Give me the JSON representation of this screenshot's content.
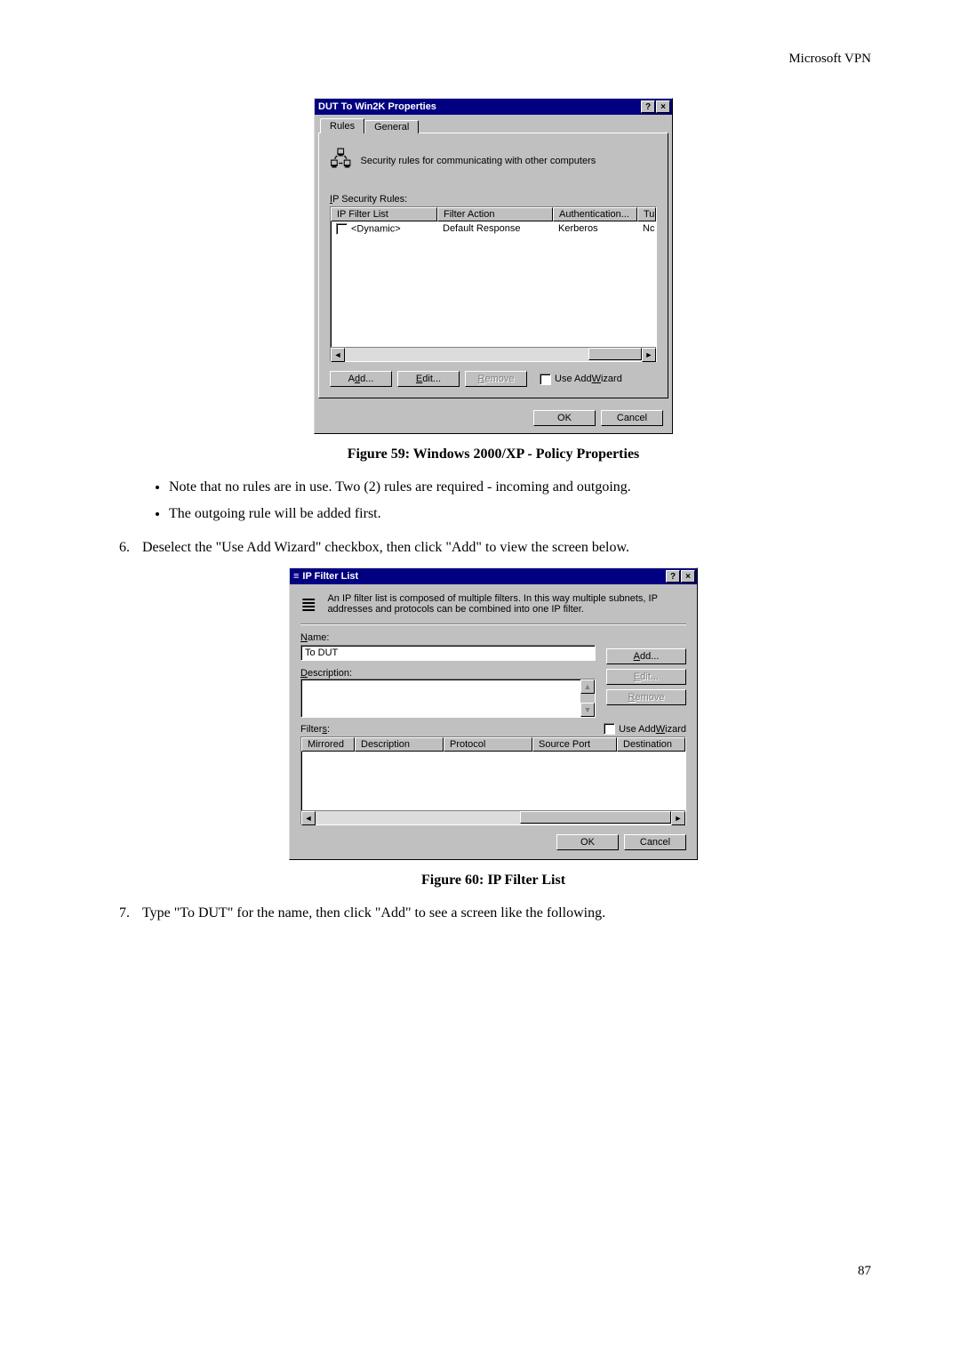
{
  "doc": {
    "header": "Microsoft VPN",
    "page_number": "87"
  },
  "dialog1": {
    "title": "DUT To Win2K Properties",
    "tabs": {
      "rules": "Rules",
      "general": "General"
    },
    "intro": "Security rules for communicating with other computers",
    "list_label_prefix": "I",
    "list_label": "P Security Rules:",
    "columns": {
      "c1": "IP Filter List",
      "c2": "Filter Action",
      "c3": "Authentication...",
      "c4": "Tu"
    },
    "row": {
      "c1": "<Dynamic>",
      "c2": "Default Response",
      "c3": "Kerberos",
      "c4": "Nc"
    },
    "buttons": {
      "add_u": "d",
      "add_rest": "d...",
      "edit_u": "E",
      "edit_rest": "dit...",
      "remove_u": "R",
      "remove_rest": "emove",
      "ok": "OK",
      "cancel": "Cancel"
    },
    "wizard_u": "W",
    "wizard_prefix": " Use Add ",
    "wizard_suffix": "izard",
    "add_prefix": "A"
  },
  "fig59": "Figure 59: Windows 2000/XP - Policy Properties",
  "bullets": {
    "b1": "Note that no rules are in use. Two (2) rules are required - incoming and outgoing.",
    "b2": "The outgoing rule will be added first."
  },
  "step6": "Deselect the \"Use Add Wizard\" checkbox, then click \"Add\" to view the screen below.",
  "dialog2": {
    "title": "IP Filter List",
    "intro": "An IP filter list is composed of multiple filters. In this way multiple subnets, IP addresses and protocols can be combined into one IP filter.",
    "name_label_u": "N",
    "name_label_rest": "ame:",
    "name_value": "To DUT",
    "desc_label_u": "D",
    "desc_label_rest": "escription:",
    "filters_label_prefix": "Filter",
    "filters_label_u": "s",
    "filters_label_suffix": ":",
    "wizard_prefix": "Use Add ",
    "wizard_u": "W",
    "wizard_suffix": "izard",
    "buttons": {
      "add_u": "A",
      "add_rest": "dd...",
      "edit_u": "E",
      "edit_rest": "dit...",
      "remove_u": "R",
      "remove_rest": "emove",
      "ok": "OK",
      "cancel": "Cancel"
    },
    "columns": {
      "c1": "Mirrored",
      "c2": "Description",
      "c3": "Protocol",
      "c4": "Source Port",
      "c5": "Destination"
    }
  },
  "fig60": "Figure 60: IP Filter List",
  "step7": "Type \"To DUT\" for the name, then click \"Add\" to see a screen like the following."
}
